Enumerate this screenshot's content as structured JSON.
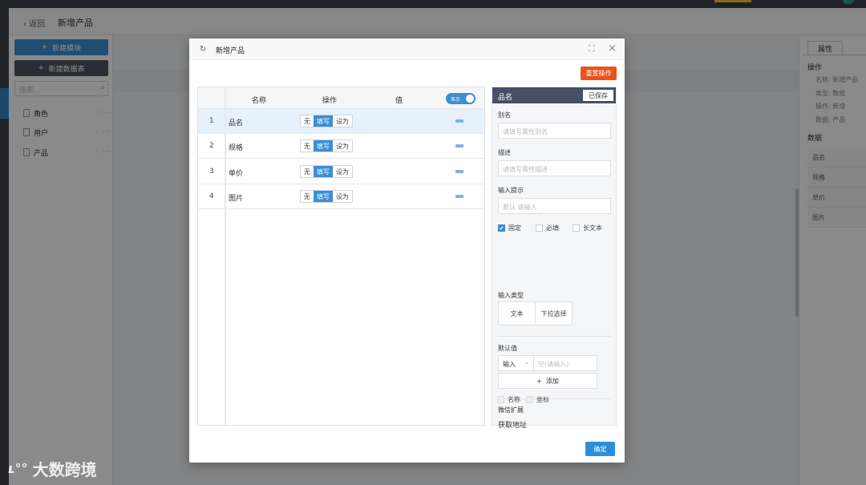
{
  "app": {
    "back_label": "返回",
    "page_title": "新增产品"
  },
  "sidebar": {
    "new_module": "新建模块",
    "new_table": "新建数据表",
    "search_placeholder": "搜索...",
    "items": [
      {
        "label": "角色"
      },
      {
        "label": "用户"
      },
      {
        "label": "产品"
      }
    ]
  },
  "right_panel": {
    "tab": "属性",
    "ops_title": "操作",
    "ops": [
      "名称: 新增产品",
      "类型: 数据",
      "操作: 新增",
      "数据: 产品"
    ],
    "data_title": "数据",
    "data_rows": [
      "品名",
      "规格",
      "单价",
      "图片"
    ]
  },
  "watermark": {
    "text": "大数跨境"
  },
  "modal": {
    "title": "新增产品",
    "reset_label": "重置操作",
    "confirm_label": "确定",
    "grid": {
      "headers": {
        "name": "名称",
        "op": "操作",
        "value": "值"
      },
      "toggle_label": "显示",
      "op_options": [
        "无",
        "填写",
        "设为"
      ],
      "rows": [
        {
          "num": "1",
          "name": "品名"
        },
        {
          "num": "2",
          "name": "规格"
        },
        {
          "num": "3",
          "name": "单价"
        },
        {
          "num": "4",
          "name": "图片"
        }
      ]
    },
    "props": {
      "title": "品名",
      "saved_label": "已保存",
      "alias_label": "别名",
      "alias_placeholder": "请填写属性别名",
      "desc_label": "描述",
      "desc_placeholder": "请填写属性描述",
      "hint_label": "输入提示",
      "hint_placeholder": "默认 请输入",
      "checks": [
        {
          "label": "固定",
          "checked": true
        },
        {
          "label": "必填",
          "checked": false
        },
        {
          "label": "长文本",
          "checked": false
        }
      ],
      "input_type_label": "输入类型",
      "input_types": [
        "文本",
        "下拉选择"
      ],
      "default_label": "默认值",
      "default_select": "输入",
      "default_placeholder": "空(请输入)",
      "add_label": "添加",
      "wechat_label": "微信扩展",
      "get_address_label": "获取地址",
      "wechat_checks": [
        "名称",
        "坐标"
      ]
    }
  }
}
